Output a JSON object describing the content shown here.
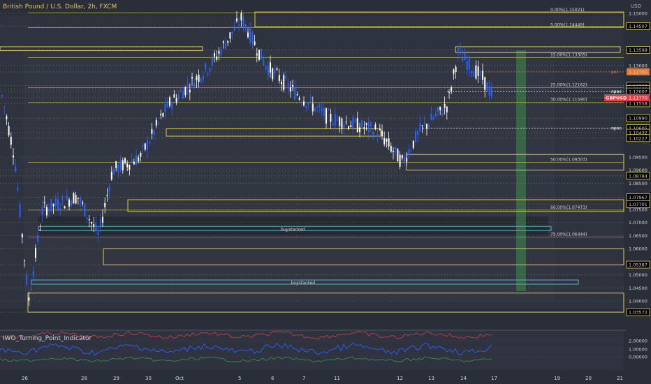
{
  "header": {
    "title": "British Pound / U.S. Dollar, 2h, FXCM",
    "currency": "USD"
  },
  "indicator": {
    "title": "IWO_Turning_Point_Indicator",
    "scale": [
      "2.00000",
      "1.00000",
      "0.00000"
    ]
  },
  "colors": {
    "background": "#2a2e39",
    "candle_up": "#2962ff",
    "candle_down": "#ffffff",
    "zone": "#e0c94a",
    "fib": "#e0c94a",
    "npoc": "#ffffff",
    "poc": "#e07a3a",
    "buystacked": "#5ab0c8",
    "green_zone": "#3a7a4a",
    "price_tag": "#f23645"
  },
  "chart_data": {
    "type": "candlestick",
    "symbol": "GBPUSD",
    "interval": "2h",
    "price_axis": {
      "ticks": [
        "1.15000",
        "1.14507",
        "1.13599",
        "1.13000",
        "1.12760",
        "1.12229",
        "1.12102",
        "1.12007",
        "1.11770",
        "1.11558",
        "1.10990",
        "1.10605",
        "1.10432",
        "1.10227",
        "1.09500",
        "1.09000",
        "1.08784",
        "1.08500",
        "1.07967",
        "1.07701",
        "1.07500",
        "1.07000",
        "1.06500",
        "1.06000",
        "1.05387",
        "1.05000",
        "1.04500",
        "1.04000",
        "1.03572"
      ],
      "current_label": "GBPUSD",
      "current_value": "1.11770"
    },
    "time_axis": [
      "26",
      "28",
      "29",
      "30",
      "Oct",
      "5",
      "6",
      "7",
      "11",
      "12",
      "13",
      "14",
      "17",
      "19",
      "20",
      "21"
    ],
    "fib_levels": [
      {
        "label": "0.00%(1.15021)",
        "value": 1.15021
      },
      {
        "label": "5.00%(1.14449)",
        "value": 1.14449
      },
      {
        "label": "15.00%(1.13305)",
        "value": 1.13305
      },
      {
        "label": "25.00%(1.12162)",
        "value": 1.12162
      },
      {
        "label": "30.00%(1.11590)",
        "value": 1.1159
      },
      {
        "label": "50.00%(1.09303)",
        "value": 1.09303
      },
      {
        "label": "66.00%(1.07473)",
        "value": 1.07473
      },
      {
        "label": "75.00%(1.06444)",
        "value": 1.06444
      }
    ],
    "zones": [
      {
        "top": 1.1505,
        "bottom": 1.1448
      },
      {
        "top": 1.1372,
        "bottom": 1.1357
      },
      {
        "top": 1.1372,
        "bottom": 1.135
      },
      {
        "top": 1.1058,
        "bottom": 1.103
      },
      {
        "top": 1.096,
        "bottom": 1.09
      },
      {
        "top": 1.0787,
        "bottom": 1.0742
      },
      {
        "top": 1.06,
        "bottom": 1.0538
      },
      {
        "top": 1.043,
        "bottom": 1.0357
      }
    ],
    "line_labels": [
      {
        "label": "poc",
        "value": 1.1276
      },
      {
        "label": "npoc",
        "value": 1.12007
      },
      {
        "label": "npoc",
        "value": 1.10605
      }
    ],
    "buystacked": [
      {
        "label": "buystacked",
        "top": 1.0685,
        "bottom": 1.0675
      },
      {
        "label": "buystacked",
        "top": 1.048,
        "bottom": 1.0468
      }
    ]
  }
}
